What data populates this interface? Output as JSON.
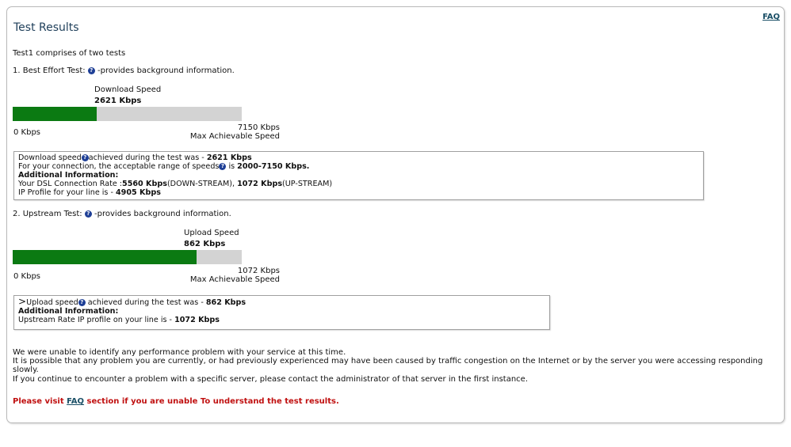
{
  "header": {
    "title": "Test Results",
    "faq_label": "FAQ"
  },
  "intro": "Test1 comprises of two tests",
  "test1": {
    "label": "1. Best Effort Test:",
    "suffix": "-provides background information.",
    "speed_title": "Download  Speed",
    "speed_value": "2621 Kbps",
    "min_label": "0 Kbps",
    "max_value": "7150 Kbps",
    "max_caption": "Max Achievable Speed",
    "fill_fraction": 0.3666,
    "info": {
      "line1_pre": "Download speed",
      "line1_mid": "achieved during the test was - ",
      "line1_val": "2621 Kbps",
      "line2_pre": "For your connection, the acceptable range of speeds",
      "line2_mid": " is ",
      "line2_val": "2000-7150 Kbps",
      "line2_end": ".",
      "additional": "Additional Information:",
      "line4_pre": "Your DSL Connection Rate :",
      "line4_val1": "5560 Kbps",
      "line4_mid1": "(DOWN-STREAM), ",
      "line4_val2": "1072 Kbps",
      "line4_mid2": "(UP-STREAM)",
      "line5_pre": "IP Profile for your line is - ",
      "line5_val": "4905 Kbps"
    }
  },
  "test2": {
    "label": "2. Upstream Test:",
    "suffix": "-provides background information.",
    "speed_title": "Upload Speed",
    "speed_value": "862 Kbps",
    "min_label": "0 Kbps",
    "max_value": "1072 Kbps",
    "max_caption": "Max Achievable Speed",
    "fill_fraction": 0.804,
    "info": {
      "marker": ">",
      "line1_pre": "Upload speed",
      "line1_mid": " achieved during the test was - ",
      "line1_val": "862 Kbps",
      "additional": "Additional Information:",
      "line3_pre": "Upstream Rate IP profile on your line is - ",
      "line3_val": "1072 Kbps"
    }
  },
  "summary": {
    "p1": "We were unable to identify any performance problem with your service at this time.",
    "p2": "It is possible that any problem you are currently, or had previously experienced may have been caused by traffic congestion on the Internet or by the server you were accessing responding slowly.",
    "p3": "If you continue to encounter a problem with a specific server, please contact the administrator of that server in the first instance."
  },
  "visit": {
    "pre": "Please visit ",
    "link": "FAQ",
    "post": " section if you are unable To understand the test results."
  },
  "colors": {
    "bar_fill": "#0b7a12",
    "bar_track": "#d3d3d3",
    "help_icon": "#1e3f96",
    "alert": "#c01010"
  }
}
